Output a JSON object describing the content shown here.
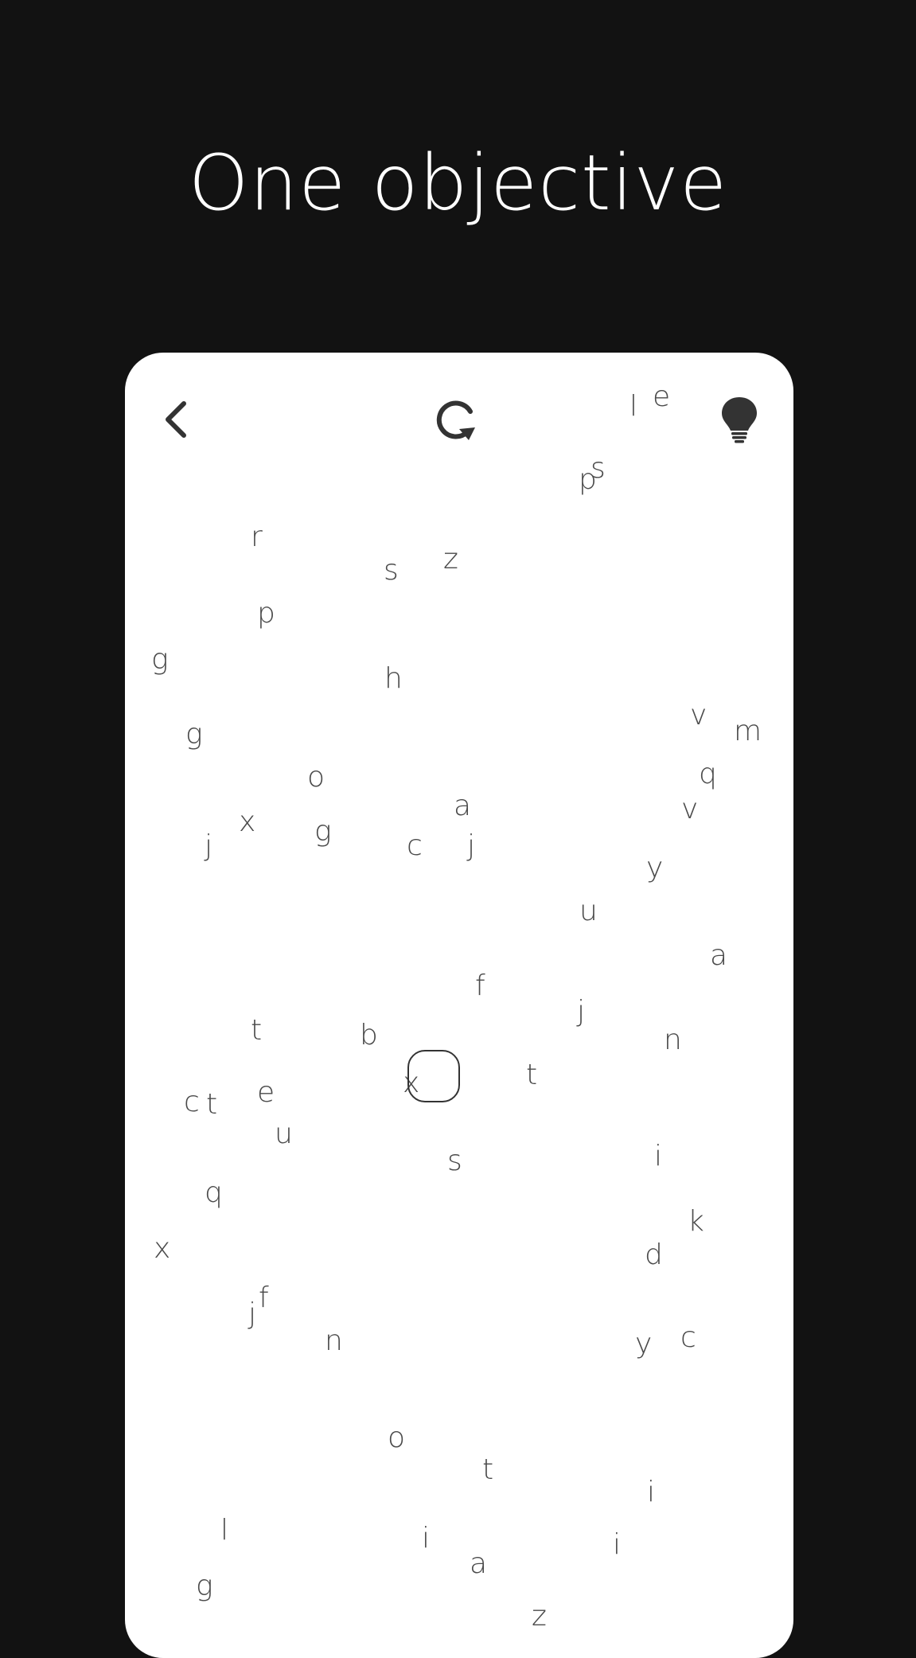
{
  "headline": "One objective",
  "toolbar": {
    "back": "back-arrow",
    "restart": "restart-arrow",
    "hint": "lightbulb"
  },
  "colors": {
    "background": "#121212",
    "card": "#ffffff",
    "letters": "#4a4a4a",
    "icons": "#333333"
  },
  "letters": [
    "l",
    "e",
    "p",
    "s",
    "r",
    "s",
    "z",
    "p",
    "g",
    "h",
    "v",
    "m",
    "g",
    "o",
    "q",
    "a",
    "v",
    "x",
    "j",
    "g",
    "c",
    "j",
    "y",
    "u",
    "a",
    "f",
    "j",
    "t",
    "b",
    "n",
    "x",
    "t",
    "e",
    "c",
    "t",
    "u",
    "i",
    "s",
    "q",
    "k",
    "x",
    "d",
    "f",
    "j",
    "n",
    "y",
    "c",
    "o",
    "t",
    "i",
    "l",
    "i",
    "a",
    "i",
    "g",
    "z"
  ]
}
